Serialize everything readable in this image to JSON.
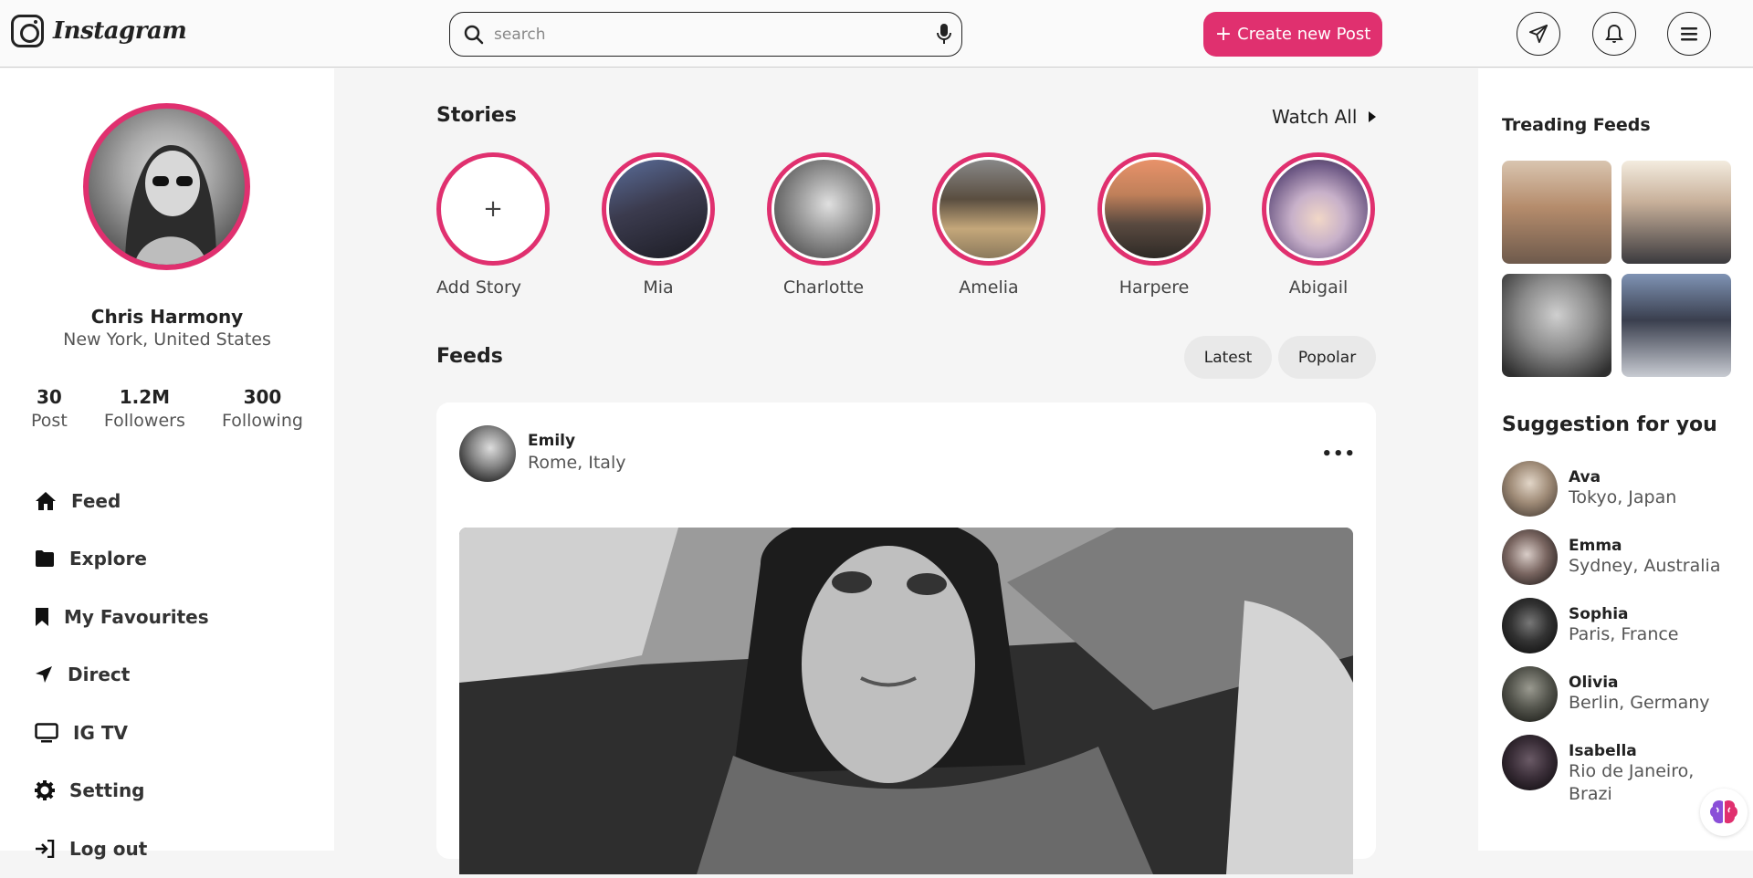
{
  "app": {
    "name": "Instagram"
  },
  "header": {
    "search_placeholder": "search",
    "create_label": "Create new Post"
  },
  "profile": {
    "name": "Chris Harmony",
    "location": "New York, United States",
    "stats": [
      {
        "value": "30",
        "label": "Post"
      },
      {
        "value": "1.2M",
        "label": "Followers"
      },
      {
        "value": "300",
        "label": "Following"
      }
    ]
  },
  "nav": [
    {
      "label": "Feed",
      "icon": "home-icon"
    },
    {
      "label": "Explore",
      "icon": "folder-icon"
    },
    {
      "label": "My Favourites",
      "icon": "bookmark-icon"
    },
    {
      "label": "Direct",
      "icon": "send-icon"
    },
    {
      "label": "IG TV",
      "icon": "tv-icon"
    },
    {
      "label": "Setting",
      "icon": "gear-icon"
    },
    {
      "label": "Log out",
      "icon": "logout-icon"
    }
  ],
  "stories": {
    "title": "Stories",
    "watch_all": "Watch All",
    "add_label": "Add Story",
    "items": [
      "Mia",
      "Charlotte",
      "Amelia",
      "Harpere",
      "Abigail"
    ]
  },
  "feeds": {
    "title": "Feeds",
    "filters": [
      "Latest",
      "Popolar"
    ],
    "post": {
      "user": "Emily",
      "location": "Rome, Italy"
    }
  },
  "trending": {
    "title": "Treading Feeds"
  },
  "suggestions": {
    "title": "Suggestion for you",
    "items": [
      {
        "name": "Ava",
        "location": "Tokyo, Japan"
      },
      {
        "name": "Emma",
        "location": "Sydney, Australia"
      },
      {
        "name": "Sophia",
        "location": "Paris, France"
      },
      {
        "name": "Olivia",
        "location": "Berlin, Germany"
      },
      {
        "name": "Isabella",
        "location": "Rio de Janeiro, Brazi"
      }
    ]
  },
  "colors": {
    "accent": "#e0306f",
    "text": "#222222",
    "muted": "#555555",
    "background": "#f5f5f5"
  }
}
